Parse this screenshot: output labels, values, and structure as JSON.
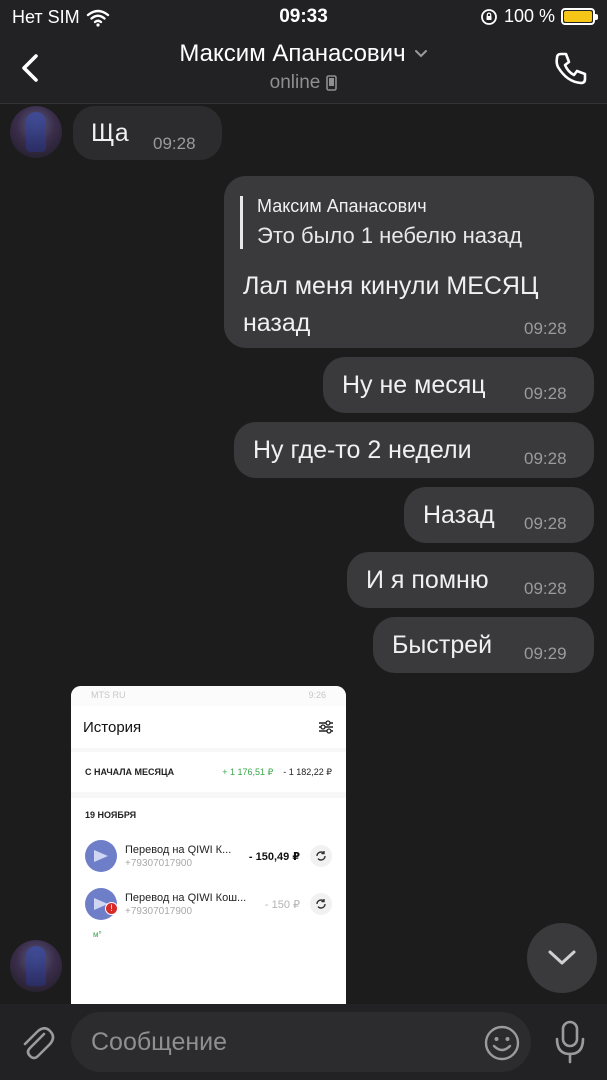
{
  "status_bar": {
    "carrier": "Нет SIM",
    "time": "09:33",
    "battery": "100 %",
    "battery_color": "#f5c518"
  },
  "header": {
    "contact_name": "Максим Апанасович",
    "presence": "online",
    "back_icon": "chevron-left-icon",
    "call_icon": "phone-icon"
  },
  "messages": [
    {
      "direction": "incoming",
      "text": "Ща",
      "time": "09:28"
    },
    {
      "direction": "outgoing",
      "reply_to": {
        "author": "Максим Апанасович",
        "text": "Это было 1 небелю назад"
      },
      "text_line1": "Лал меня кинули МЕСЯЦ",
      "text_line2": "назад",
      "time": "09:28"
    },
    {
      "direction": "outgoing",
      "text": "Ну не месяц",
      "time": "09:28"
    },
    {
      "direction": "outgoing",
      "text": "Ну где-то 2 недели",
      "time": "09:28"
    },
    {
      "direction": "outgoing",
      "text": "Назад",
      "time": "09:28"
    },
    {
      "direction": "outgoing",
      "text": "И я помню",
      "time": "09:28"
    },
    {
      "direction": "outgoing",
      "text": "Быстрей",
      "time": "09:29"
    }
  ],
  "attachment": {
    "status_left": "MTS RU",
    "status_right": "9:26",
    "title": "История",
    "summary_label": "С НАЧАЛА МЕСЯЦА",
    "summary_income": "+ 1 176,51 ₽",
    "summary_expense": "- 1 182,22 ₽",
    "date_header": "19 НОЯБРЯ",
    "transactions": [
      {
        "title": "Перевод на QIWI К...",
        "phone": "+79307017900",
        "amount": "- 150,49 ₽"
      },
      {
        "title": "Перевод на QIWI Кош...",
        "phone": "+79307017900",
        "amount": "- 150 ₽"
      }
    ],
    "mark": "м°"
  },
  "composer": {
    "placeholder": "Сообщение",
    "value": ""
  }
}
